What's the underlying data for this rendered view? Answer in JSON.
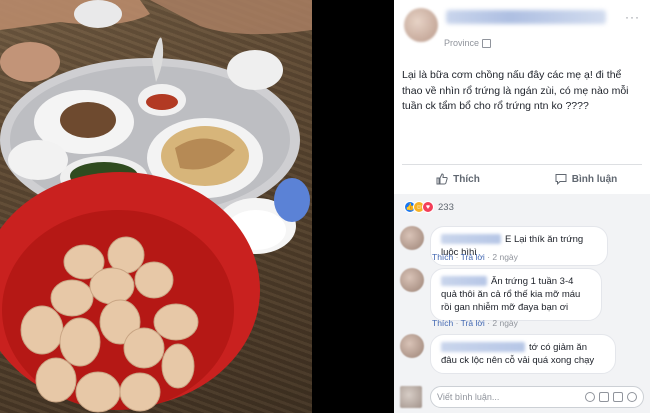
{
  "post": {
    "author_name": "",
    "location": "Province",
    "text": "Lại là bữa cơm chồng nấu đây các mẹ ạ! đi thể thao về nhìn rổ trứng là ngán zùi, có mẹ nào mỗi tuần ck tẩm bổ cho rổ trứng ntn ko ????",
    "more_menu": "···"
  },
  "actions": {
    "like_label": "Thích",
    "comment_label": "Bình luận"
  },
  "reactions": {
    "count": "233",
    "icons": [
      "like-icon",
      "haha-icon",
      "love-icon"
    ]
  },
  "comments": [
    {
      "text": "E Lại thík ăn trứng luộc hìhì",
      "like": "Thích",
      "reply": "Trả lời",
      "time": "2 ngày"
    },
    {
      "text": "Ăn trứng 1 tuần 3-4 quả thôi ăn cả rổ thế kia mỡ máu rồi gan nhiễm mỡ đaya bạn ơi",
      "like": "Thích",
      "reply": "Trả lời",
      "time": "2 ngày"
    },
    {
      "text": "tớ có giảm ăn đâu ck lộc nên cỗ vải quá xong chạy",
      "like": "",
      "reply": "",
      "time": ""
    }
  ],
  "composer": {
    "placeholder": "Viết bình luận..."
  },
  "colors": {
    "link_blue": "#4267b2",
    "like_blue": "#1877f2",
    "love_red": "#f33e58",
    "haha_yellow": "#f7b125"
  }
}
